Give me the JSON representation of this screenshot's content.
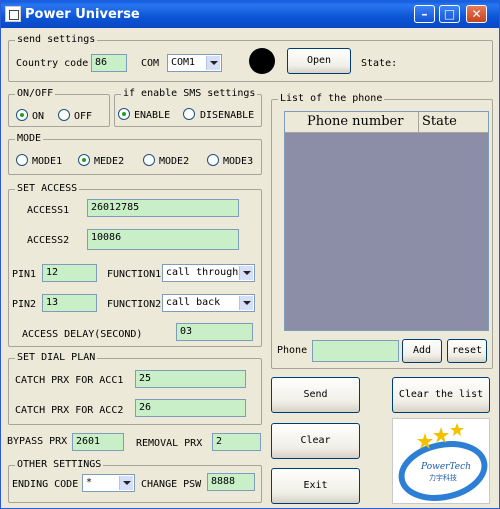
{
  "window": {
    "title": "Power Universe"
  },
  "send_settings": {
    "legend": "send settings",
    "country_code_label": "Country code",
    "country_code": "86",
    "com_label": "COM",
    "com_value": "COM1",
    "open_label": "Open",
    "state_label": "State:"
  },
  "onoff": {
    "legend": "ON/OFF",
    "on": "ON",
    "off": "OFF",
    "selected": "ON"
  },
  "sms": {
    "legend": "if enable SMS settings",
    "enable": "ENABLE",
    "disable": "DISENABLE",
    "selected": "ENABLE"
  },
  "mode": {
    "legend": "MODE",
    "m1": "MODE1",
    "m2": "MEDE2",
    "m3": "MODE2",
    "m4": "MODE3",
    "selected": "MEDE2"
  },
  "access": {
    "legend": "SET ACCESS",
    "access1_label": "ACCESS1",
    "access1": "26012785",
    "access2_label": "ACCESS2",
    "access2": "10086",
    "pin1_label": "PIN1",
    "pin1": "12",
    "pin2_label": "PIN2",
    "pin2": "13",
    "function1_label": "FUNCTION1",
    "function1": "call through",
    "function2_label": "FUNCTION2",
    "function2": "call back",
    "delay_label": "ACCESS DELAY(SECOND)",
    "delay": "03"
  },
  "dial": {
    "legend": "SET DIAL PLAN",
    "acc1_label": "CATCH PRX FOR ACC1",
    "acc1": "25",
    "acc2_label": "CATCH PRX FOR ACC2",
    "acc2": "26"
  },
  "bypass": {
    "label": "BYPASS PRX",
    "value": "2601",
    "removal_label": "REMOVAL PRX",
    "removal": "2"
  },
  "other": {
    "legend": "OTHER SETTINGS",
    "ending_label": "ENDING CODE",
    "ending": "*",
    "change_label": "CHANGE PSW",
    "change": "8888"
  },
  "phone_list": {
    "legend": "List of the phone",
    "columns": [
      "Phone number",
      "State"
    ],
    "phone_label": "Phone",
    "phone_value": "",
    "add_label": "Add",
    "reset_label": "reset"
  },
  "actions": {
    "send": "Send",
    "clear_list": "Clear the list",
    "clear": "Clear",
    "exit": "Exit"
  },
  "logo": {
    "text1": "PowerTech",
    "text2": "力宇科技"
  }
}
